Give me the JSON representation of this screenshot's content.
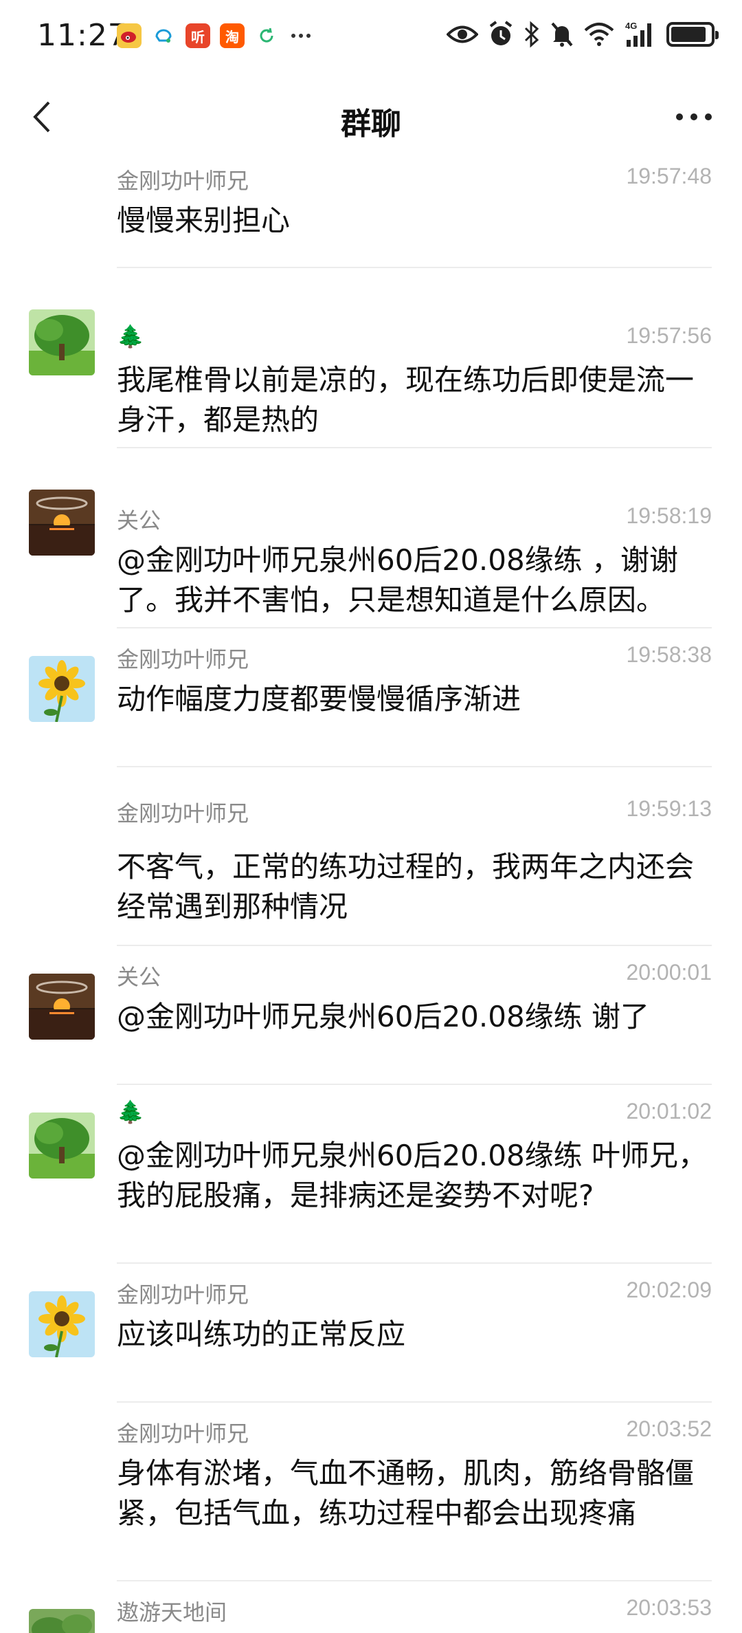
{
  "status_bar": {
    "time": "11:27",
    "notif_icons": [
      "weibo-icon",
      "qq-icon",
      "ting-icon",
      "taobao-icon",
      "sync-icon",
      "more-notifications-icon"
    ],
    "ting_label": "听",
    "taobao_label": "淘",
    "network": "4G",
    "battery_level": 0.9
  },
  "title_bar": {
    "title": "群聊"
  },
  "messages": [
    {
      "sender": "金刚功叶师兄",
      "time": "19:57:48",
      "text": "慢慢来别担心",
      "avatar": "none"
    },
    {
      "sender": "🌲",
      "time": "19:57:56",
      "text": "我尾椎骨以前是凉的，现在练功后即使是流一身汗，都是热的",
      "avatar": "tree"
    },
    {
      "sender": "关公",
      "time": "19:58:19",
      "text": "@金刚功叶师兄泉州60后20.08缘练 ，谢谢了。我并不害怕，只是想知道是什么原因。",
      "avatar": "sunset"
    },
    {
      "sender": "金刚功叶师兄",
      "time": "19:58:38",
      "text": "动作幅度力度都要慢慢循序渐进",
      "avatar": "sunflower"
    },
    {
      "sender": "金刚功叶师兄",
      "time": "19:59:13",
      "text": "不客气，正常的练功过程的，我两年之内还会经常遇到那种情况",
      "avatar": "none"
    },
    {
      "sender": "关公",
      "time": "20:00:01",
      "text": "@金刚功叶师兄泉州60后20.08缘练 谢了",
      "avatar": "sunset"
    },
    {
      "sender": "🌲",
      "time": "20:01:02",
      "text": "@金刚功叶师兄泉州60后20.08缘练 叶师兄，我的屁股痛，是排病还是姿势不对呢?",
      "avatar": "tree"
    },
    {
      "sender": "金刚功叶师兄",
      "time": "20:02:09",
      "text": "应该叫练功的正常反应",
      "avatar": "sunflower"
    },
    {
      "sender": "金刚功叶师兄",
      "time": "20:03:52",
      "text": "身体有淤堵，气血不通畅，肌肉，筋络骨骼僵紧，包括气血，练功过程中都会出现疼痛",
      "avatar": "none"
    },
    {
      "sender": "遨游天地间",
      "time": "20:03:53",
      "text": "",
      "avatar": "garden"
    }
  ]
}
